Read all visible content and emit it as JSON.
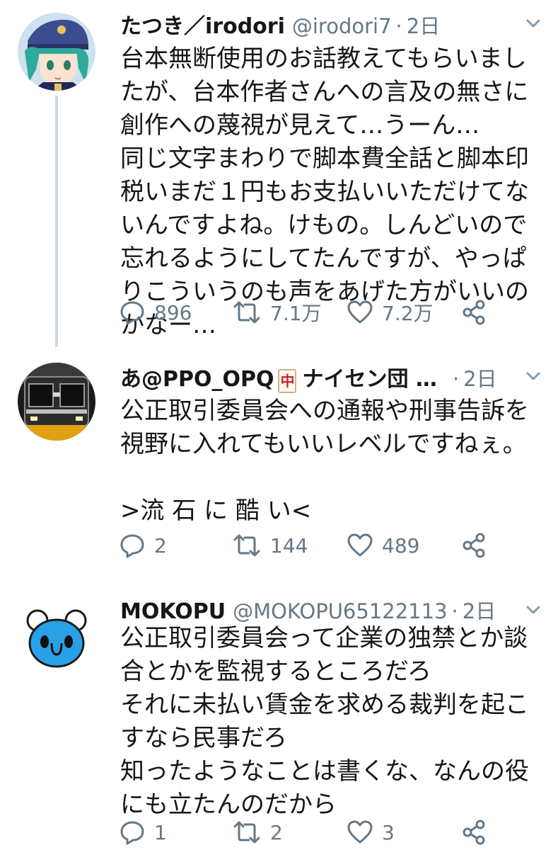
{
  "colors": {
    "text": "#14171a",
    "secondary": "#657786",
    "thread_line": "#ccd6dd"
  },
  "tweets": [
    {
      "display_name": "たつき／irodori",
      "handle": "@irodori7",
      "separator": "·",
      "time": "2日",
      "text": "台本無断使用のお話教えてもらいましたが、台本作者さんへの言及の無さに創作への蔑視が見えて…うーん…\n同じ文字まわりで脚本費全話と脚本印税いまだ１円もお支払いいただけてないんですよね。けもの。しんどいので忘れるようにしてたんですが、やっぱりこういうのも声をあげた方がいいのかなー…",
      "reply_count": "896",
      "retweet_count": "7.1万",
      "like_count": "7.2万",
      "avatar_icon": "anime-character-avatar"
    },
    {
      "display_name": "あ@PPO_OPQ",
      "name_suffix": "ナイセン団 …",
      "name_emoji": "中",
      "separator": "·",
      "time": "2日",
      "text": "公正取引委員会への通報や刑事告訴を視野に入れてもいいレベルですねぇ。\n\n>流 石 に 酷 い<",
      "reply_count": "2",
      "retweet_count": "144",
      "like_count": "489",
      "avatar_icon": "train-avatar"
    },
    {
      "display_name": "MOKOPU",
      "handle": "@MOKOPU65122113",
      "separator": "·",
      "time": "2日",
      "text": "公正取引委員会って企業の独禁とか談合とかを監視するところだろ\nそれに未払い賃金を求める裁判を起こすなら民事だろ\n知ったようなことは書くな、なんの役にも立たんのだから",
      "reply_count": "1",
      "retweet_count": "2",
      "like_count": "3",
      "avatar_icon": "blue-bear-avatar"
    }
  ]
}
